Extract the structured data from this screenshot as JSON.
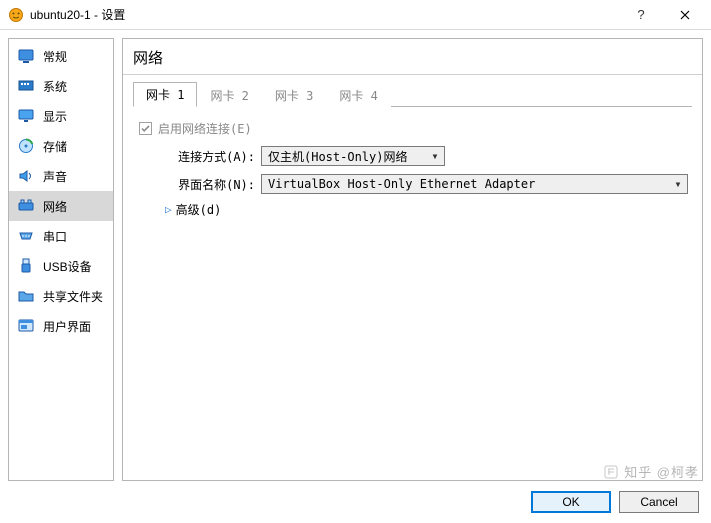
{
  "window": {
    "title": "ubuntu20-1 - 设置"
  },
  "sidebar": {
    "items": [
      {
        "id": "general",
        "label": "常规"
      },
      {
        "id": "system",
        "label": "系统"
      },
      {
        "id": "display",
        "label": "显示"
      },
      {
        "id": "storage",
        "label": "存储"
      },
      {
        "id": "audio",
        "label": "声音"
      },
      {
        "id": "network",
        "label": "网络",
        "selected": true
      },
      {
        "id": "serial",
        "label": "串口"
      },
      {
        "id": "usb",
        "label": "USB设备"
      },
      {
        "id": "shared-folders",
        "label": "共享文件夹"
      },
      {
        "id": "ui",
        "label": "用户界面"
      }
    ]
  },
  "panel": {
    "title": "网络"
  },
  "tabs": [
    {
      "label": "网卡 1",
      "active": true
    },
    {
      "label": "网卡 2",
      "active": false
    },
    {
      "label": "网卡 3",
      "active": false
    },
    {
      "label": "网卡 4",
      "active": false
    }
  ],
  "form": {
    "enable_label": "启用网络连接(E)",
    "enable_checked": true,
    "attached_label": "连接方式(A):",
    "attached_value": "仅主机(Host-Only)网络",
    "name_label": "界面名称(N):",
    "name_value": "VirtualBox Host-Only Ethernet Adapter",
    "advanced_label": "高级(d)"
  },
  "buttons": {
    "ok": "OK",
    "cancel": "Cancel"
  },
  "watermark": {
    "text": "知乎 @柯孝"
  }
}
